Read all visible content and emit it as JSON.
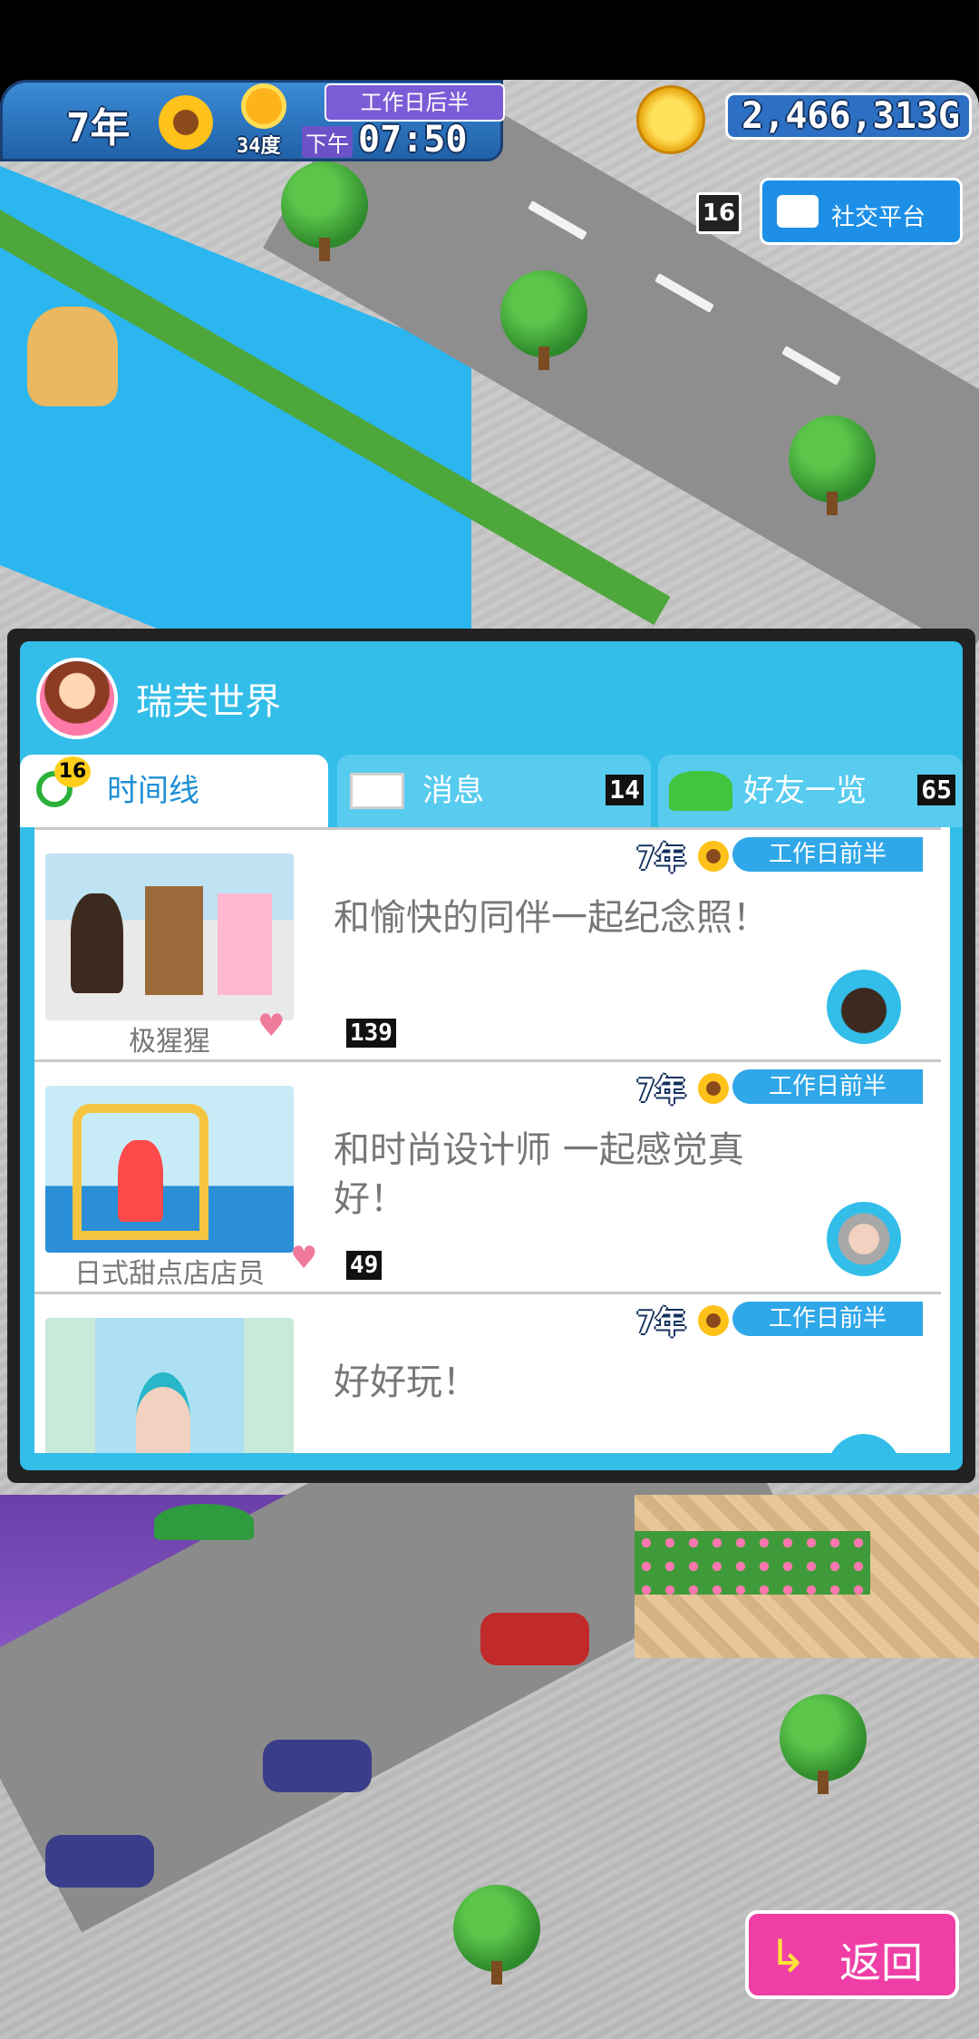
{
  "hud": {
    "year": "7年",
    "temperature": "34度",
    "time_of_day": "下午",
    "clock": "07:50",
    "phase": "工作日后半",
    "money": "2,466,313G"
  },
  "social": {
    "count": "16",
    "label": "社交平台"
  },
  "panel": {
    "world_name": "瑞芙世界",
    "tabs": [
      {
        "label": "时间线",
        "badge": "16"
      },
      {
        "label": "消息",
        "count": "14"
      },
      {
        "label": "好友一览",
        "count": "65"
      }
    ],
    "posts": [
      {
        "year": "7年",
        "phase": "工作日前半",
        "text": "和愉快的同伴一起纪念照！",
        "author": "极猩猩",
        "likes": "139"
      },
      {
        "year": "7年",
        "phase": "工作日前半",
        "text": "和时尚设计师 一起感觉真好！",
        "author": "日式甜点店店员",
        "likes": "49"
      },
      {
        "year": "7年",
        "phase": "工作日前半",
        "text": "好好玩！",
        "author": "",
        "likes": ""
      }
    ]
  },
  "buttons": {
    "back": "返回"
  },
  "colors": {
    "panel_blue": "#33bde9",
    "accent_pink": "#ef3fa6",
    "hud_blue": "#2d6fc2"
  }
}
